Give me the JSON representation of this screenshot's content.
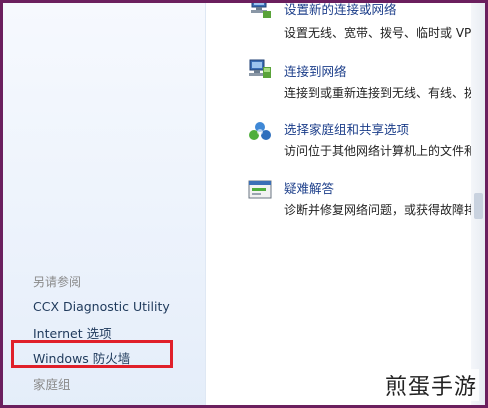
{
  "tasks": [
    {
      "icon": "network-setup-icon",
      "title": "设置新的连接或网络",
      "desc": "设置无线、宽带、拨号、临时或 VPN 连"
    },
    {
      "icon": "connect-network-icon",
      "title": "连接到网络",
      "desc": "连接到或重新连接到无线、有线、拨号"
    },
    {
      "icon": "homegroup-icon",
      "title": "选择家庭组和共享选项",
      "desc": "访问位于其他网络计算机上的文件和打"
    },
    {
      "icon": "troubleshoot-icon",
      "title": "疑难解答",
      "desc": "诊断并修复网络问题，或获得故障排除信"
    }
  ],
  "sidebar": {
    "see_also_title": "另请参阅",
    "links": [
      "CCX Diagnostic Utility",
      "Internet 选项",
      "Windows 防火墙",
      "家庭组"
    ]
  },
  "watermark": "煎蛋手游",
  "colors": {
    "frame": "#6b1f5e",
    "highlight": "#e0202a",
    "link": "#1c3e8a"
  }
}
